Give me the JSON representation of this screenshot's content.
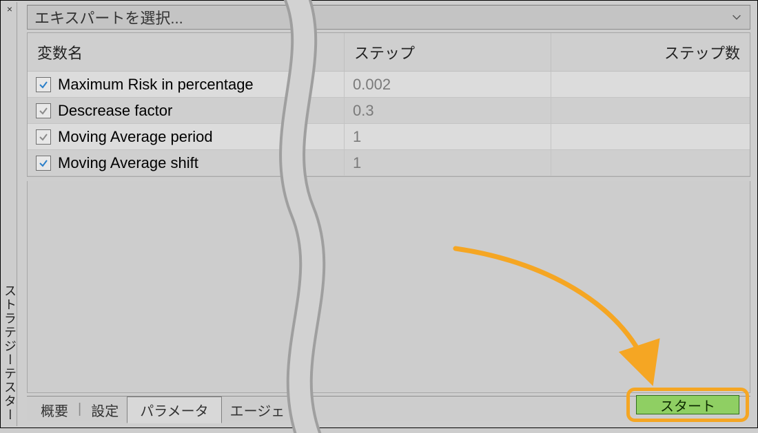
{
  "side": {
    "close_glyph": "×",
    "title": "ストラテジーテスター"
  },
  "expert_selector": {
    "placeholder": "エキスパートを選択..."
  },
  "table": {
    "headers": {
      "name": "変数名",
      "step": "ステップ",
      "count": "ステップ数"
    },
    "rows": [
      {
        "checked": true,
        "check_style": "blue",
        "name": "Maximum Risk in percentage",
        "step": "0.002",
        "count": ""
      },
      {
        "checked": true,
        "check_style": "gray",
        "name": "Descrease factor",
        "step": "0.3",
        "count": ""
      },
      {
        "checked": true,
        "check_style": "gray",
        "name": "Moving Average period",
        "step": "1",
        "count": ""
      },
      {
        "checked": true,
        "check_style": "blue",
        "name": "Moving Average shift",
        "step": "1",
        "count": ""
      }
    ]
  },
  "tabs": {
    "overview": "概要",
    "settings": "設定",
    "parameters": "パラメータ",
    "agents_truncated": "エージェ"
  },
  "start_button": {
    "label": "スタート"
  },
  "colors": {
    "highlight": "#f5a623",
    "start_bg": "#8fcf63"
  }
}
